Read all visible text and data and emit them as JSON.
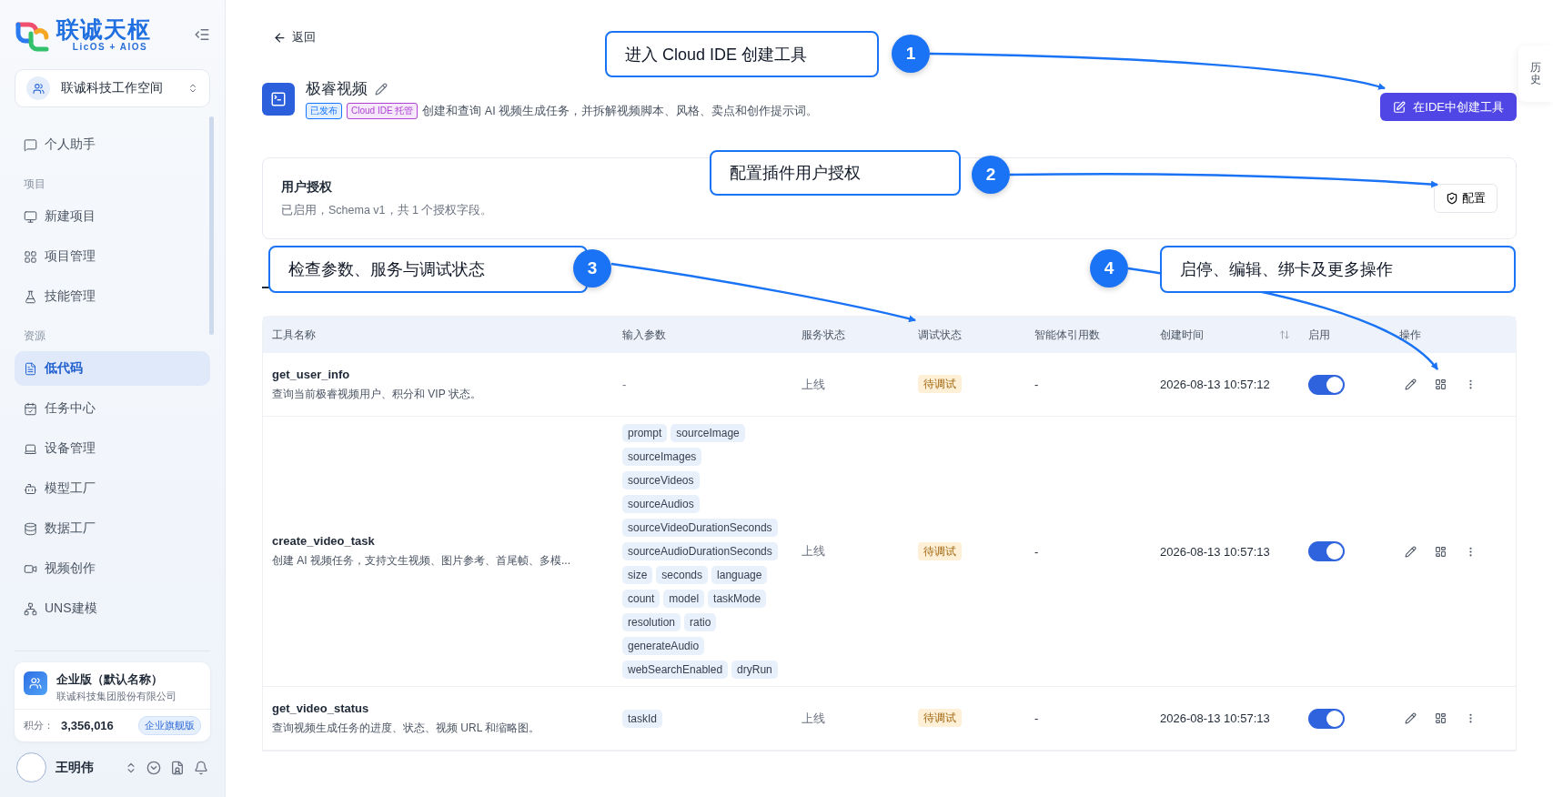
{
  "brand": {
    "name": "联诚天枢",
    "tagline": "LicOS + AIOS"
  },
  "workspace": {
    "name": "联诚科技工作空间"
  },
  "sidebar": {
    "items": [
      {
        "kind": "item",
        "label": "个人助手",
        "selected": false
      },
      {
        "kind": "section",
        "label": "项目"
      },
      {
        "kind": "item",
        "label": "新建项目",
        "selected": false
      },
      {
        "kind": "item",
        "label": "项目管理",
        "selected": false
      },
      {
        "kind": "item",
        "label": "技能管理",
        "selected": false
      },
      {
        "kind": "section",
        "label": "资源"
      },
      {
        "kind": "item",
        "label": "低代码",
        "selected": true
      },
      {
        "kind": "item",
        "label": "任务中心",
        "selected": false
      },
      {
        "kind": "item",
        "label": "设备管理",
        "selected": false
      },
      {
        "kind": "item",
        "label": "模型工厂",
        "selected": false
      },
      {
        "kind": "item",
        "label": "数据工厂",
        "selected": false
      },
      {
        "kind": "item",
        "label": "视频创作",
        "selected": false
      },
      {
        "kind": "item",
        "label": "UNS建模",
        "selected": false
      }
    ]
  },
  "org_card": {
    "title": "企业版（默认名称）",
    "company": "联诚科技集团股份有限公司",
    "points_label": "积分：",
    "points": "3,356,016",
    "plan": "企业旗舰版"
  },
  "user": {
    "name": "王明伟"
  },
  "back": "返回",
  "plugin": {
    "title": "极睿视频",
    "tags": [
      {
        "label": "已发布",
        "color": "#1677ff"
      },
      {
        "label": "Cloud IDE 托管",
        "color": "#b042d6"
      }
    ],
    "description": "创建和查询 AI 视频生成任务，并拆解视频脚本、风格、卖点和创作提示词。",
    "create_button": "在IDE中创建工具"
  },
  "history_tab": "历史",
  "auth": {
    "title": "用户授权",
    "summary": "已启用，Schema v1，共 1 个授权字段。",
    "button": "配置"
  },
  "table": {
    "columns": [
      {
        "label": "工具名称",
        "sortable": false
      },
      {
        "label": "输入参数",
        "sortable": false
      },
      {
        "label": "服务状态",
        "sortable": false
      },
      {
        "label": "调试状态",
        "sortable": false
      },
      {
        "label": "智能体引用数",
        "sortable": false
      },
      {
        "label": "创建时间",
        "sortable": true
      },
      {
        "label": "启用",
        "sortable": false
      },
      {
        "label": "操作",
        "sortable": false
      }
    ],
    "rows": [
      {
        "name": "get_user_info",
        "description": "查询当前极睿视频用户、积分和 VIP 状态。",
        "params_empty": "-",
        "service": "上线",
        "debug": "待调试",
        "refs": "-",
        "created": "2026-08-13 10:57:12",
        "enabled": true
      },
      {
        "name": "create_video_task",
        "description": "创建 AI 视频任务，支持文生视频、图片参考、首尾帧、多模...",
        "params": [
          "prompt",
          "sourceImage",
          "sourceImages",
          "sourceVideos",
          "sourceAudios",
          "sourceVideoDurationSeconds",
          "sourceAudioDurationSeconds",
          "size",
          "seconds",
          "language",
          "count",
          "model",
          "taskMode",
          "resolution",
          "ratio",
          "generateAudio",
          "webSearchEnabled",
          "dryRun"
        ],
        "service": "上线",
        "debug": "待调试",
        "refs": "-",
        "created": "2026-08-13 10:57:13",
        "enabled": true
      },
      {
        "name": "get_video_status",
        "description": "查询视频生成任务的进度、状态、视频 URL 和缩略图。",
        "params": [
          "taskId"
        ],
        "service": "上线",
        "debug": "待调试",
        "refs": "-",
        "created": "2026-08-13 10:57:13",
        "enabled": true
      }
    ]
  },
  "callouts": [
    {
      "number": "1",
      "text": "进入 Cloud IDE 创建工具"
    },
    {
      "number": "2",
      "text": "配置插件用户授权"
    },
    {
      "number": "3",
      "text": "检查参数、服务与调试状态"
    },
    {
      "number": "4",
      "text": "启停、编辑、绑卡及更多操作"
    }
  ]
}
